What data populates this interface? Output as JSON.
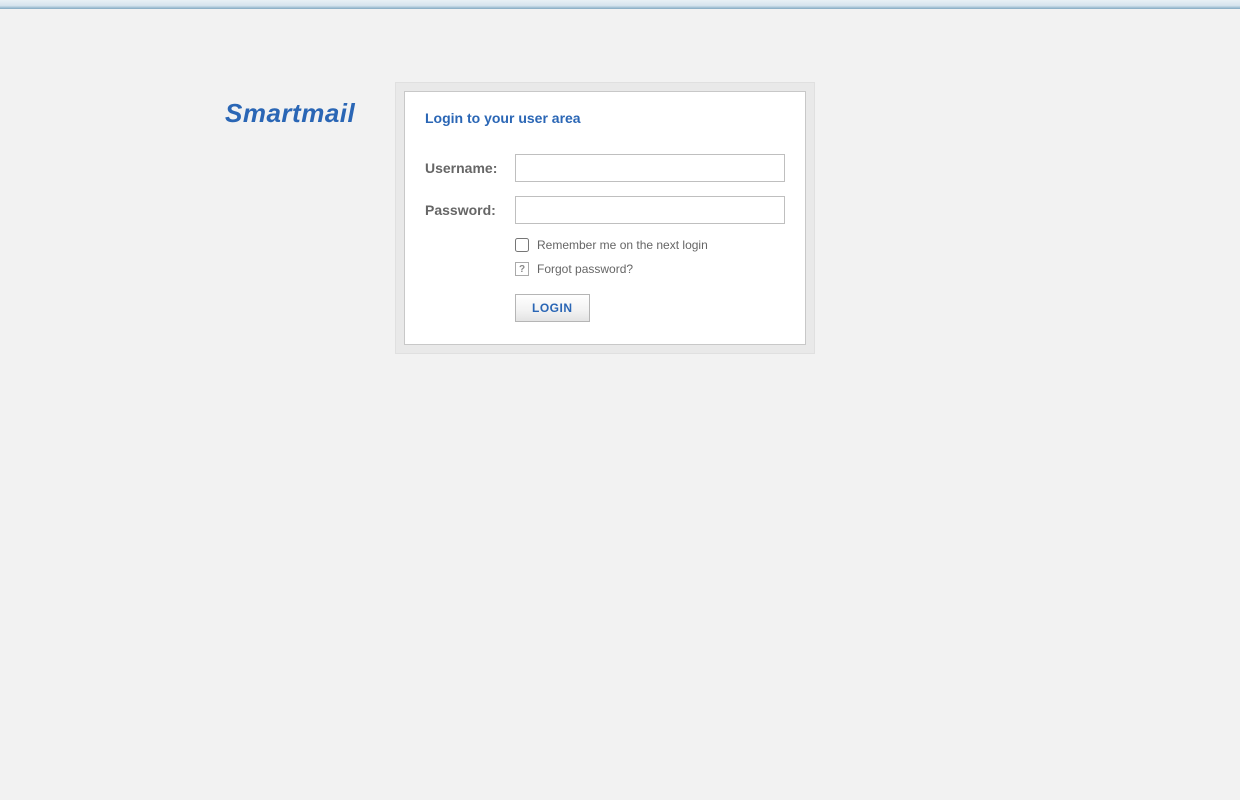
{
  "brand": "Smartmail",
  "login_panel": {
    "title": "Login to your user area",
    "username_label": "Username:",
    "username_value": "",
    "password_label": "Password:",
    "password_value": "",
    "remember_label": "Remember me on the next login",
    "help_icon_char": "?",
    "forgot_label": "Forgot password?",
    "login_button_label": "LOGIN"
  },
  "colors": {
    "accent": "#2a66b5",
    "panel_bg": "#e9e9e9",
    "page_bg": "#f2f2f2"
  }
}
